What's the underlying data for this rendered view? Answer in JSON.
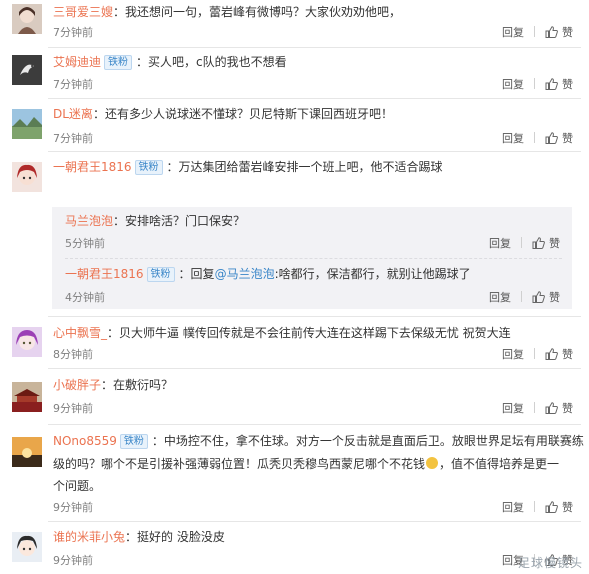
{
  "comments": [
    {
      "user": "三哥爱三嫂",
      "badge": "",
      "text": "：我还想问一句，蕾岩峰有微博吗？大家伙劝劝他吧，",
      "time": "7分钟前",
      "reply": "回复",
      "like": "赞"
    },
    {
      "user": "艾姆迪迪",
      "badge": "铁粉",
      "text": "：买人吧，c队的我也不想看",
      "time": "7分钟前",
      "reply": "回复",
      "like": "赞"
    },
    {
      "user": "DL迷离",
      "badge": "",
      "text": "：还有多少人说球迷不懂球？贝尼特斯下课回西班牙吧！",
      "time": "7分钟前",
      "reply": "回复",
      "like": "赞"
    },
    {
      "user": "一朝君王1816",
      "badge": "铁粉",
      "text": "：万达集团给蕾岩峰安排一个班上吧，他不适合踢球",
      "time": "",
      "reply": "",
      "like": ""
    },
    {
      "user": "心中飘雪_",
      "badge": "",
      "text": "：贝大师牛逼 幞传回传就是不会往前传大连在这样踢下去保级无忧 祝贺大连",
      "time": "8分钟前",
      "reply": "回复",
      "like": "赞"
    },
    {
      "user": "小破胖子",
      "badge": "",
      "text": "：在敷衍吗？",
      "time": "9分钟前",
      "reply": "回复",
      "like": "赞"
    },
    {
      "user": "NOno8559",
      "badge": "铁粉",
      "text": "：中场控不住，拿不住球。对方一个反击就是直面后卫。放眼世界足坛有用联赛练",
      "text2": "级的吗？哪个不是引援补强薄弱位置！瓜秃贝秃穆鸟西蒙尼哪个不花钱",
      "text3": "，值不值得培养是更一",
      "text4": "个问题。",
      "time": "9分钟前",
      "reply": "回复",
      "like": "赞"
    },
    {
      "user": "谁的米菲小兔",
      "badge": "",
      "text": "：挺好的 没脸没皮",
      "time": "9分钟前",
      "reply": "回复",
      "like": "赞"
    }
  ],
  "replies": [
    {
      "user": "马兰泡泡",
      "badge": "",
      "text": "：安排啥活？门口保安？",
      "time": "5分钟前",
      "reply": "回复",
      "like": "赞"
    },
    {
      "user": "一朝君王1816",
      "badge": "铁粉",
      "prefix": "：回复",
      "mention": "@马兰泡泡",
      "text": ":啥都行，保洁都行，就别让他踢球了",
      "time": "4分钟前",
      "reply": "回复",
      "like": "赞"
    }
  ],
  "avatar_icons": [
    "girl-avatar-icon",
    "bird-avatar-icon",
    "landscape-avatar-icon",
    "anime-avatar-icon",
    "purple-avatar-icon",
    "temple-avatar-icon",
    "sunset-avatar-icon",
    "cartoon-avatar-icon"
  ],
  "watermark": "足球慢镜头",
  "colors": {
    "username": "#eb7350",
    "link": "#3a86c8",
    "badge_bg": "#e8f2fb",
    "reply_bg": "#f2f2f5"
  }
}
